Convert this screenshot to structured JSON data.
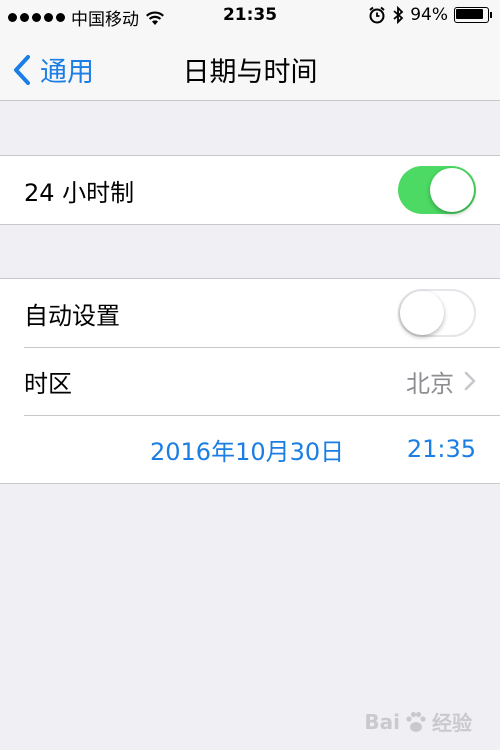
{
  "status_bar": {
    "carrier": "中国移动",
    "time": "21:35",
    "battery_percent": "94%",
    "battery_level": 0.94,
    "icons": [
      "signal-dots-icon",
      "wifi-icon",
      "alarm-icon",
      "bluetooth-icon",
      "battery-icon"
    ]
  },
  "nav": {
    "back_label": "通用",
    "title": "日期与时间"
  },
  "settings": {
    "twenty_four_hour": {
      "label": "24 小时制",
      "on": true
    },
    "auto_set": {
      "label": "自动设置",
      "on": false
    },
    "time_zone": {
      "label": "时区",
      "value": "北京"
    },
    "date": "2016年10月30日",
    "time": "21:35"
  },
  "watermark": {
    "text_left": "Bai",
    "text_right": "经验"
  },
  "colors": {
    "accent": "#1a7ee4",
    "toggle_on": "#4cd964",
    "background": "#efeff4",
    "separator": "#c8c7cc",
    "secondary_text": "#8e8e93"
  }
}
